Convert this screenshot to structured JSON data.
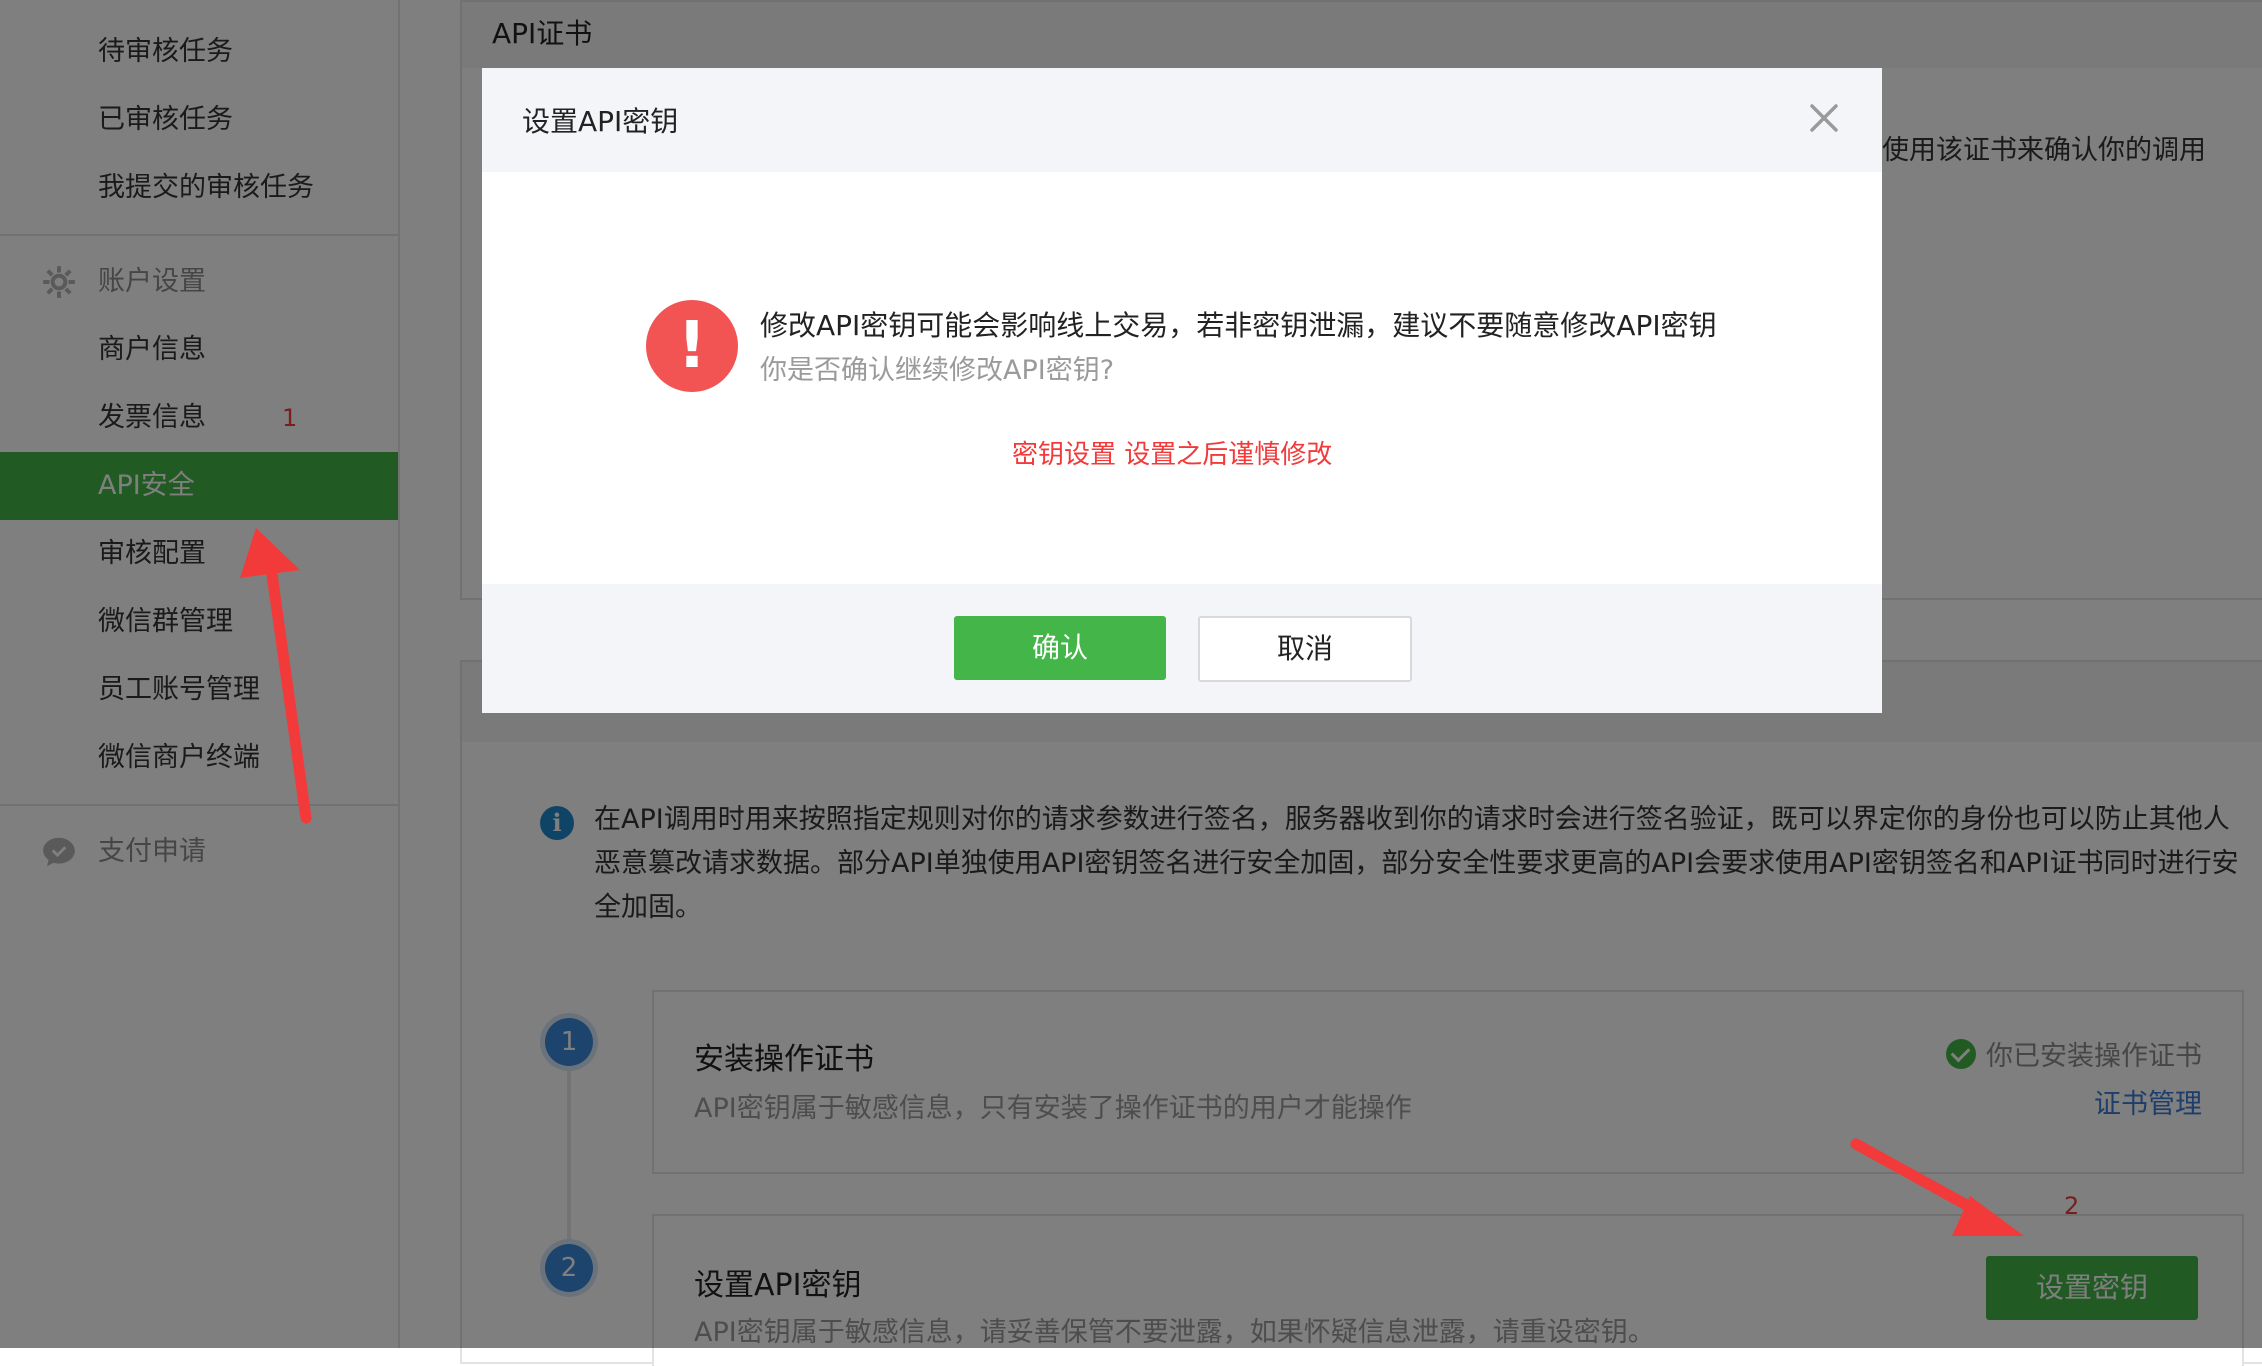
{
  "sidebar": {
    "items_top": [
      {
        "label": "待审核任务"
      },
      {
        "label": "已审核任务"
      },
      {
        "label": "我提交的审核任务"
      }
    ],
    "group_account": {
      "label": "账户设置",
      "icon": "gear-icon"
    },
    "items_account": [
      {
        "label": "商户信息"
      },
      {
        "label": "发票信息"
      },
      {
        "label": "API安全"
      },
      {
        "label": "审核配置"
      },
      {
        "label": "微信群管理"
      },
      {
        "label": "员工账号管理"
      },
      {
        "label": "微信商户终端"
      }
    ],
    "group_pay": {
      "label": "支付申请",
      "icon": "chat-bubble-icon"
    },
    "active_color": "#44b549"
  },
  "annotations": {
    "num1": "1",
    "num2": "2",
    "color": "#f23a3a"
  },
  "main": {
    "cert_panel_title": "API证书",
    "cert_intro_tail": "使用该证书来确认你的调用",
    "info_text": "在API调用时用来按照指定规则对你的请求参数进行签名，服务器收到你的请求时会进行签名验证，既可以界定你的身份也可以防止其他人恶意篡改请求数据。部分API单独使用API密钥签名进行安全加固，部分安全性要求更高的API会要求使用API密钥签名和API证书同时进行安全加固。",
    "steps": [
      {
        "num": "1",
        "title": "安装操作证书",
        "desc": "API密钥属于敏感信息，只有安装了操作证书的用户才能操作",
        "status": "你已安装操作证书",
        "link": "证书管理"
      },
      {
        "num": "2",
        "title": "设置API密钥",
        "desc": "API密钥属于敏感信息，请妥善保管不要泄露，如果怀疑信息泄露，请重设密钥。",
        "button": "设置密钥"
      }
    ]
  },
  "modal": {
    "title": "设置API密钥",
    "warning": "修改API密钥可能会影响线上交易，若非密钥泄漏，建议不要随意修改API密钥",
    "question": "你是否确认继续修改API密钥?",
    "annotation": "密钥设置  设置之后谨慎修改",
    "confirm": "确认",
    "cancel": "取消"
  }
}
